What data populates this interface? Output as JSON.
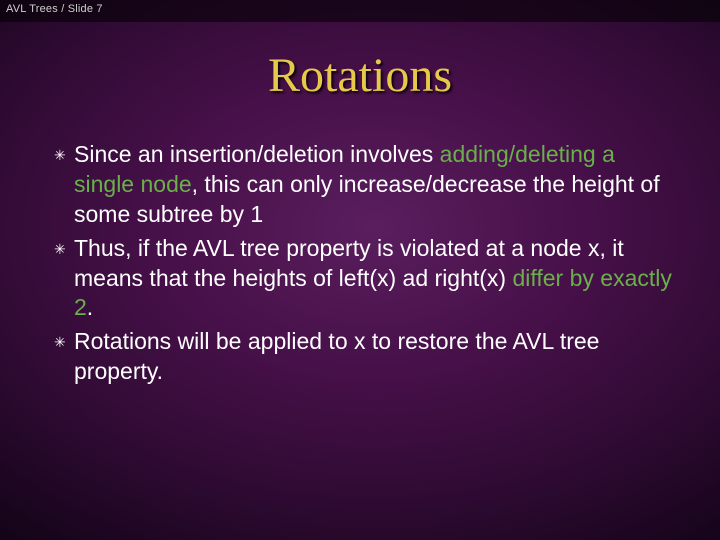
{
  "crumb": "AVL Trees / Slide 7",
  "title": "Rotations",
  "bullets": {
    "b1": {
      "a": "Since an insertion/deletion involves ",
      "b": "adding/deleting a single node",
      "c": ", this can only increase/decrease the height of some subtree by 1"
    },
    "b2": {
      "a": "Thus, if the AVL tree property is violated at a node x, it means that the heights of left(x) ad right(x) ",
      "b": "differ by exactly 2",
      "c": "."
    },
    "b3": {
      "a": "Rotations will be applied to x to restore the AVL tree property."
    }
  },
  "bullet_glyph": "✳"
}
